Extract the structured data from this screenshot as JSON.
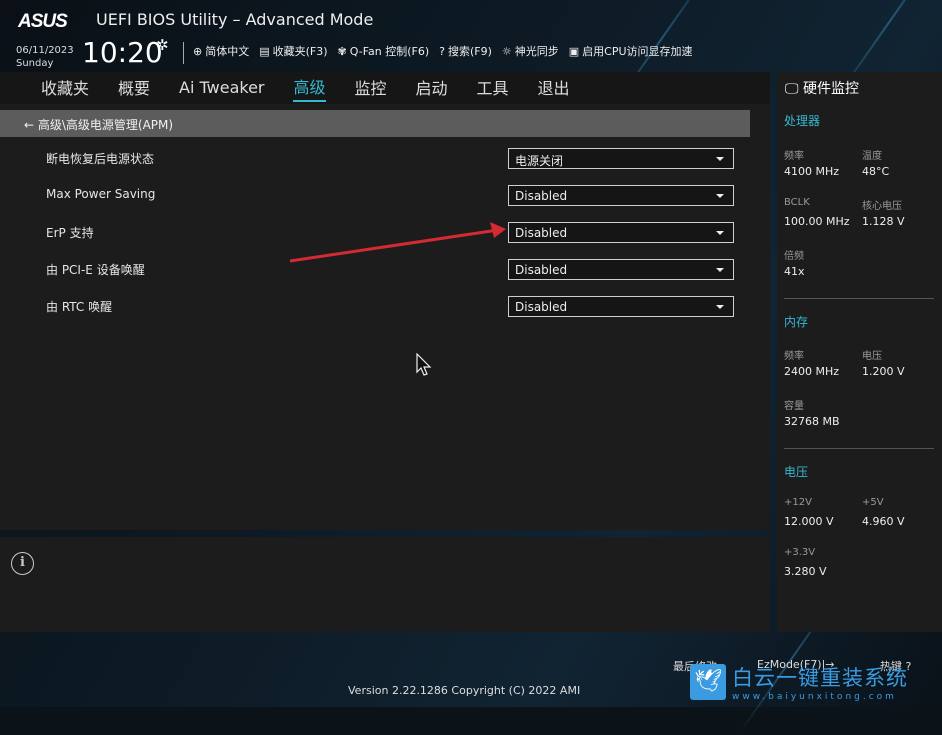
{
  "header": {
    "logo": "ASUS",
    "title": "UEFI BIOS Utility – Advanced Mode",
    "date": "06/11/2023",
    "weekday": "Sunday",
    "time": "10:20",
    "tools": [
      {
        "icon": "globe-icon",
        "glyph": "⊕",
        "label": "简体中文"
      },
      {
        "icon": "favorites-icon",
        "glyph": "▤",
        "label": "收藏夹(F3)"
      },
      {
        "icon": "fan-icon",
        "glyph": "✾",
        "label": "Q-Fan 控制(F6)"
      },
      {
        "icon": "search-help-icon",
        "glyph": "?",
        "label": "搜索(F9)"
      },
      {
        "icon": "aura-icon",
        "glyph": "☼",
        "label": "神光同步"
      },
      {
        "icon": "memory-icon",
        "glyph": "▣",
        "label": "启用CPU访问显存加速"
      }
    ]
  },
  "nav": {
    "tabs": [
      "收藏夹",
      "概要",
      "Ai Tweaker",
      "高级",
      "监控",
      "启动",
      "工具",
      "退出"
    ],
    "active": "高级"
  },
  "breadcrumb": "高级\\高级电源管理(APM)",
  "settings": [
    {
      "label": "断电恢复后电源状态",
      "value": "电源关闭"
    },
    {
      "label": "Max Power Saving",
      "value": "Disabled"
    },
    {
      "label": "ErP 支持",
      "value": "Disabled"
    },
    {
      "label": "由 PCI-E 设备唤醒",
      "value": "Disabled"
    },
    {
      "label": "由 RTC 唤醒",
      "value": "Disabled"
    }
  ],
  "hw": {
    "title": "硬件监控",
    "cpu": {
      "title": "处理器",
      "freq_l": "频率",
      "freq": "4100 MHz",
      "temp_l": "温度",
      "temp": "48°C",
      "bclk_l": "BCLK",
      "bclk": "100.00 MHz",
      "vcore_l": "核心电压",
      "vcore": "1.128 V",
      "ratio_l": "倍频",
      "ratio": "41x"
    },
    "mem": {
      "title": "内存",
      "freq_l": "频率",
      "freq": "2400 MHz",
      "volt_l": "电压",
      "volt": "1.200 V",
      "cap_l": "容量",
      "cap": "32768 MB"
    },
    "volt": {
      "title": "电压",
      "v12_l": "+12V",
      "v12": "12.000 V",
      "v5_l": "+5V",
      "v5": "4.960 V",
      "v33_l": "+3.3V",
      "v33": "3.280 V"
    }
  },
  "footer": {
    "version": "Version 2.22.1286 Copyright (C) 2022 AMI",
    "last_modified": "最后修改",
    "ezmode": "EzMode(F7)|→",
    "hotkeys": "热键 ?"
  },
  "watermark": {
    "name": "白云一键重装系统",
    "url": "www.baiyunxitong.com"
  },
  "colors": {
    "accent": "#35b8d0",
    "annotation_arrow": "#d42a33"
  }
}
